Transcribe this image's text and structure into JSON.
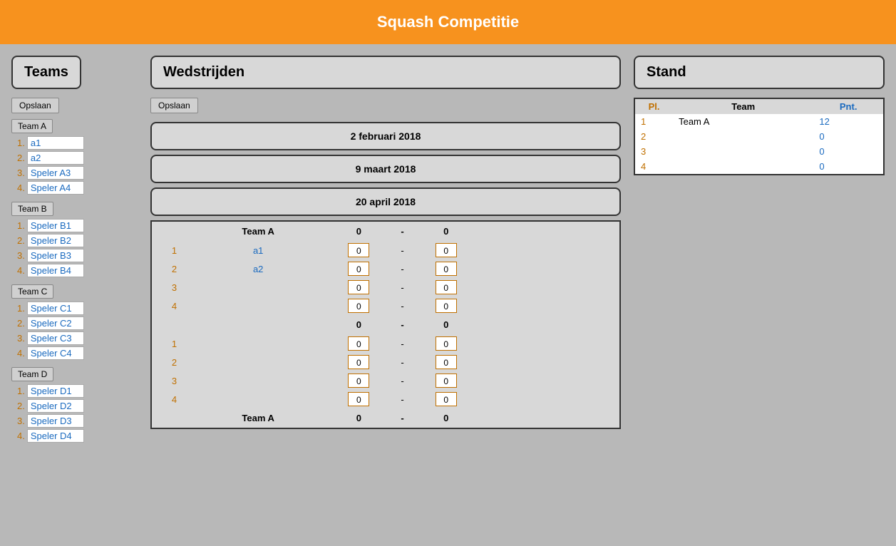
{
  "header": {
    "title": "Squash Competitie"
  },
  "left": {
    "title": "Teams",
    "save_label": "Opslaan",
    "teams": [
      {
        "label": "Team A",
        "players": [
          {
            "num": "1.",
            "name": "a1"
          },
          {
            "num": "2.",
            "name": "a2"
          },
          {
            "num": "3.",
            "name": "Speler A3"
          },
          {
            "num": "4.",
            "name": "Speler A4"
          }
        ]
      },
      {
        "label": "Team B",
        "players": [
          {
            "num": "1.",
            "name": "Speler B1"
          },
          {
            "num": "2.",
            "name": "Speler B2"
          },
          {
            "num": "3.",
            "name": "Speler B3"
          },
          {
            "num": "4.",
            "name": "Speler B4"
          }
        ]
      },
      {
        "label": "Team C",
        "players": [
          {
            "num": "1.",
            "name": "Speler C1"
          },
          {
            "num": "2.",
            "name": "Speler C2"
          },
          {
            "num": "3.",
            "name": "Speler C3"
          },
          {
            "num": "4.",
            "name": "Speler C4"
          }
        ]
      },
      {
        "label": "Team D",
        "players": [
          {
            "num": "1.",
            "name": "Speler D1"
          },
          {
            "num": "2.",
            "name": "Speler D2"
          },
          {
            "num": "3.",
            "name": "Speler D3"
          },
          {
            "num": "4.",
            "name": "Speler D4"
          }
        ]
      }
    ]
  },
  "center": {
    "title": "Wedstrijden",
    "save_label": "Opslaan",
    "dates": [
      {
        "label": "2 februari 2018"
      },
      {
        "label": "9 maart 2018"
      },
      {
        "label": "20 april 2018"
      }
    ],
    "match_block": {
      "team_a": "Team A",
      "team_b": "",
      "score_a": "0",
      "score_b": "0",
      "players": [
        {
          "num": "1",
          "name_a": "a1",
          "name_b": "",
          "score_a": "0",
          "score_b": "0"
        },
        {
          "num": "2",
          "name_a": "a2",
          "name_b": "",
          "score_a": "0",
          "score_b": "0"
        },
        {
          "num": "3",
          "name_a": "",
          "name_b": "",
          "score_a": "0",
          "score_b": "0"
        },
        {
          "num": "4",
          "name_a": "",
          "name_b": "",
          "score_a": "0",
          "score_b": "0"
        }
      ],
      "team2_score_a": "0",
      "team2_score_b": "0",
      "players2": [
        {
          "num": "1",
          "name_a": "",
          "name_b": "",
          "score_a": "0",
          "score_b": "0"
        },
        {
          "num": "2",
          "name_a": "",
          "name_b": "",
          "score_a": "0",
          "score_b": "0"
        },
        {
          "num": "3",
          "name_a": "",
          "name_b": "",
          "score_a": "0",
          "score_b": "0"
        },
        {
          "num": "4",
          "name_a": "",
          "name_b": "",
          "score_a": "0",
          "score_b": "0"
        }
      ],
      "footer_team": "Team A",
      "footer_score_a": "0",
      "footer_score_b": "0"
    }
  },
  "right": {
    "title": "Stand",
    "table": {
      "col_pl": "Pl.",
      "col_team": "Team",
      "col_pnt": "Pnt.",
      "rows": [
        {
          "pl": "1",
          "team": "Team A",
          "pnt": "12"
        },
        {
          "pl": "2",
          "team": "",
          "pnt": "0"
        },
        {
          "pl": "3",
          "team": "",
          "pnt": "0"
        },
        {
          "pl": "4",
          "team": "",
          "pnt": "0"
        }
      ]
    }
  }
}
